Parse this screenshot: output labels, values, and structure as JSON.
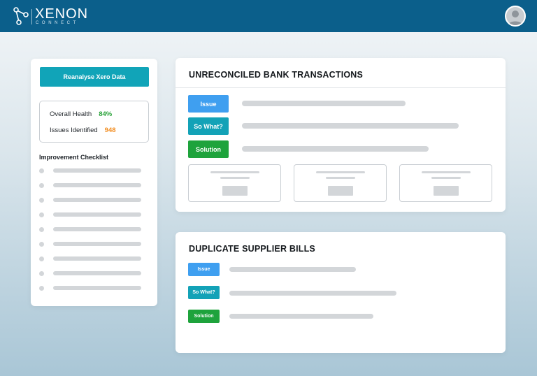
{
  "header": {
    "logo_text": "XENON",
    "logo_subtext": "CONNECT",
    "avatar_icon": "user-avatar-icon",
    "bg_color": "#0b5f8b"
  },
  "sidebar": {
    "reanalyse_label": "Reanalyse Xero Data",
    "stats": {
      "health_label": "Overall Health",
      "health_value": "84%",
      "issues_label": "Issues Identified",
      "issues_value": "948"
    },
    "checklist_title": "Improvement Checklist",
    "checklist_item_count": 9
  },
  "cards": [
    {
      "title": "UNRECONCILED BANK TRANSACTIONS",
      "tags": [
        "Issue",
        "So What?",
        "Solution"
      ],
      "summary_tile_count": 3
    },
    {
      "title": "DUPLICATE SUPPLIER BILLS",
      "tags": [
        "Issue",
        "So What?",
        "Solution"
      ]
    }
  ],
  "colors": {
    "accent_teal": "#11a4b8",
    "issue_blue": "#3f9ff0",
    "solution_green": "#1ea33c",
    "health_green": "#2aa33a",
    "issues_orange": "#f28c1f"
  }
}
